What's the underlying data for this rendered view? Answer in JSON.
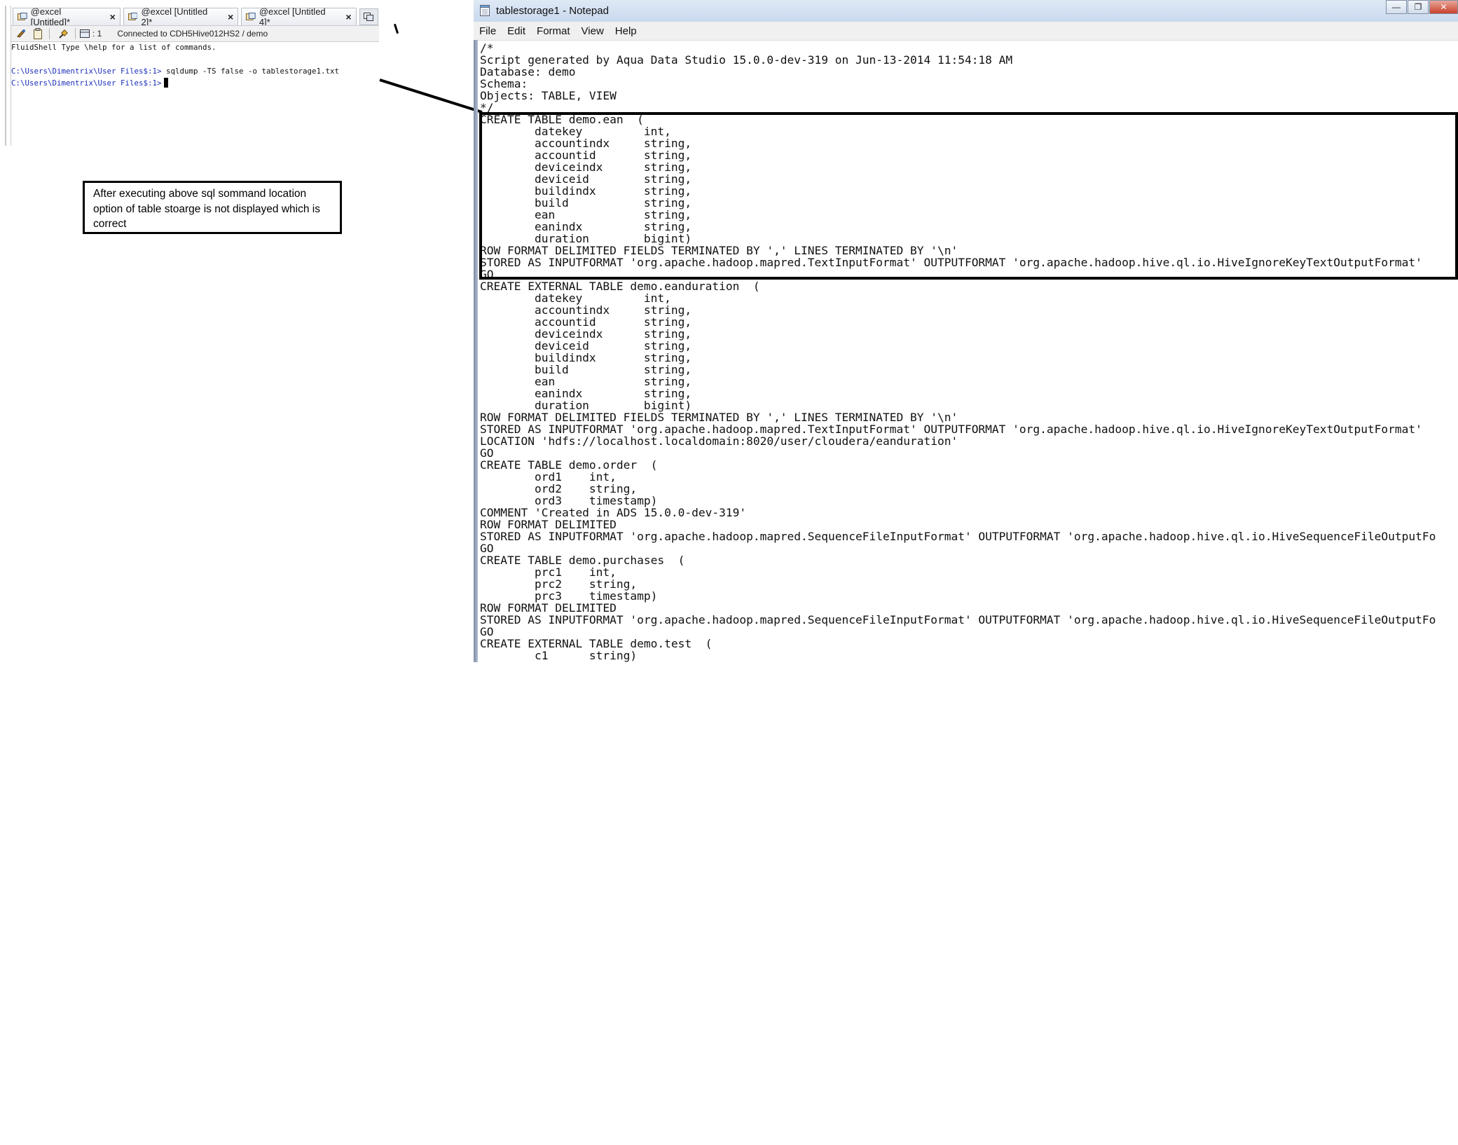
{
  "ads": {
    "tabs": [
      {
        "label": "@excel [Untitled]*"
      },
      {
        "label": "@excel [Untitled 2]*"
      },
      {
        "label": "@excel [Untitled 4]*"
      }
    ],
    "toolbar": {
      "line_count": ": 1",
      "connection_status": "Connected to CDH5Hive012HS2 / demo"
    },
    "console": {
      "lines": [
        {
          "prompt": "",
          "text": "FluidShell Type \\help for a list of commands."
        },
        {
          "prompt": "",
          "text": ""
        },
        {
          "prompt": "C:\\Users\\Dimentrix\\User Files$:1>",
          "text": " sqldump -TS false -o tablestorage1.txt"
        },
        {
          "prompt": "C:\\Users\\Dimentrix\\User Files$:1>",
          "text": ""
        }
      ]
    }
  },
  "annotation": {
    "text": "After executing above sql sommand location option of table stoarge is not displayed which is correct"
  },
  "notepad": {
    "title": "tablestorage1 - Notepad",
    "menu": [
      "File",
      "Edit",
      "Format",
      "View",
      "Help"
    ],
    "lines": [
      "/*",
      "Script generated by Aqua Data Studio 15.0.0-dev-319 on Jun-13-2014 11:54:18 AM",
      "Database: demo",
      "Schema:",
      "Objects: TABLE, VIEW",
      "*/",
      "CREATE TABLE demo.ean  (",
      "        datekey         int,",
      "        accountindx     string,",
      "        accountid       string,",
      "        deviceindx      string,",
      "        deviceid        string,",
      "        buildindx       string,",
      "        build           string,",
      "        ean             string,",
      "        eanindx         string,",
      "        duration        bigint)",
      "ROW FORMAT DELIMITED FIELDS TERMINATED BY ',' LINES TERMINATED BY '\\n'",
      "STORED AS INPUTFORMAT 'org.apache.hadoop.mapred.TextInputFormat' OUTPUTFORMAT 'org.apache.hadoop.hive.ql.io.HiveIgnoreKeyTextOutputFormat'",
      "GO",
      "CREATE EXTERNAL TABLE demo.eanduration  (",
      "        datekey         int,",
      "        accountindx     string,",
      "        accountid       string,",
      "        deviceindx      string,",
      "        deviceid        string,",
      "        buildindx       string,",
      "        build           string,",
      "        ean             string,",
      "        eanindx         string,",
      "        duration        bigint)",
      "ROW FORMAT DELIMITED FIELDS TERMINATED BY ',' LINES TERMINATED BY '\\n'",
      "STORED AS INPUTFORMAT 'org.apache.hadoop.mapred.TextInputFormat' OUTPUTFORMAT 'org.apache.hadoop.hive.ql.io.HiveIgnoreKeyTextOutputFormat'",
      "LOCATION 'hdfs://localhost.localdomain:8020/user/cloudera/eanduration'",
      "GO",
      "CREATE TABLE demo.order  (",
      "        ord1    int,",
      "        ord2    string,",
      "        ord3    timestamp)",
      "COMMENT 'Created in ADS 15.0.0-dev-319'",
      "ROW FORMAT DELIMITED",
      "STORED AS INPUTFORMAT 'org.apache.hadoop.mapred.SequenceFileInputFormat' OUTPUTFORMAT 'org.apache.hadoop.hive.ql.io.HiveSequenceFileOutputFo",
      "GO",
      "CREATE TABLE demo.purchases  (",
      "        prc1    int,",
      "        prc2    string,",
      "        prc3    timestamp)",
      "ROW FORMAT DELIMITED",
      "STORED AS INPUTFORMAT 'org.apache.hadoop.mapred.SequenceFileInputFormat' OUTPUTFORMAT 'org.apache.hadoop.hive.ql.io.HiveSequenceFileOutputFo",
      "GO",
      "CREATE EXTERNAL TABLE demo.test  (",
      "        c1      string)"
    ]
  },
  "colors": {
    "prompt": "#1a2fb8",
    "annotation_border": "#000000",
    "title_bar": "#c9d9ee"
  }
}
